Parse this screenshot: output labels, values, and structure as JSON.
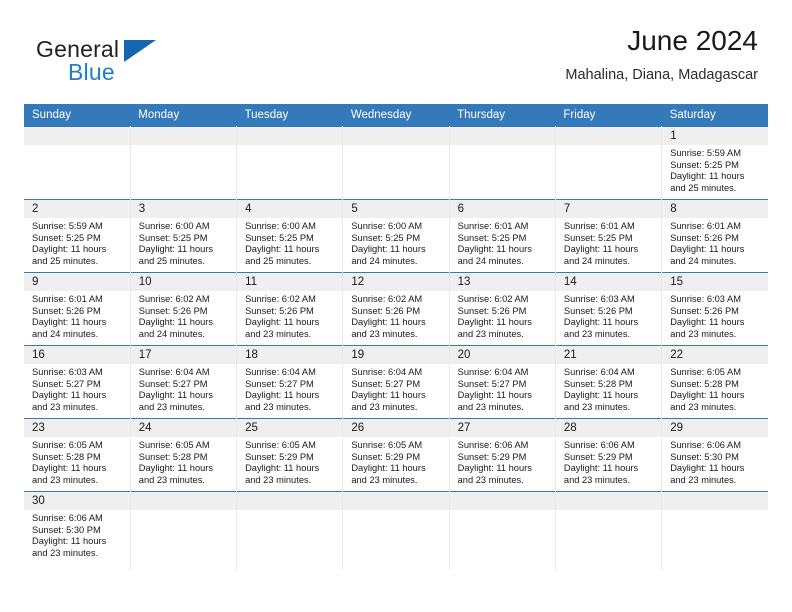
{
  "brand": {
    "logo_top": "General",
    "logo_bottom": "Blue",
    "logo_icon": "blue-triangle",
    "accent_color": "#3479b9",
    "logo_blue": "#1f7ec4",
    "header_band_color": "#efefef"
  },
  "header": {
    "title": "June 2024",
    "subtitle": "Mahalina, Diana, Madagascar"
  },
  "weekdays": [
    "Sunday",
    "Monday",
    "Tuesday",
    "Wednesday",
    "Thursday",
    "Friday",
    "Saturday"
  ],
  "weeks": [
    [
      {
        "date": "",
        "empty": true
      },
      {
        "date": "",
        "empty": true
      },
      {
        "date": "",
        "empty": true
      },
      {
        "date": "",
        "empty": true
      },
      {
        "date": "",
        "empty": true
      },
      {
        "date": "",
        "empty": true
      },
      {
        "date": "1",
        "sunrise": "Sunrise: 5:59 AM",
        "sunset": "Sunset: 5:25 PM",
        "daylight_1": "Daylight: 11 hours",
        "daylight_2": "and 25 minutes."
      }
    ],
    [
      {
        "date": "2",
        "sunrise": "Sunrise: 5:59 AM",
        "sunset": "Sunset: 5:25 PM",
        "daylight_1": "Daylight: 11 hours",
        "daylight_2": "and 25 minutes."
      },
      {
        "date": "3",
        "sunrise": "Sunrise: 6:00 AM",
        "sunset": "Sunset: 5:25 PM",
        "daylight_1": "Daylight: 11 hours",
        "daylight_2": "and 25 minutes."
      },
      {
        "date": "4",
        "sunrise": "Sunrise: 6:00 AM",
        "sunset": "Sunset: 5:25 PM",
        "daylight_1": "Daylight: 11 hours",
        "daylight_2": "and 25 minutes."
      },
      {
        "date": "5",
        "sunrise": "Sunrise: 6:00 AM",
        "sunset": "Sunset: 5:25 PM",
        "daylight_1": "Daylight: 11 hours",
        "daylight_2": "and 24 minutes."
      },
      {
        "date": "6",
        "sunrise": "Sunrise: 6:01 AM",
        "sunset": "Sunset: 5:25 PM",
        "daylight_1": "Daylight: 11 hours",
        "daylight_2": "and 24 minutes."
      },
      {
        "date": "7",
        "sunrise": "Sunrise: 6:01 AM",
        "sunset": "Sunset: 5:25 PM",
        "daylight_1": "Daylight: 11 hours",
        "daylight_2": "and 24 minutes."
      },
      {
        "date": "8",
        "sunrise": "Sunrise: 6:01 AM",
        "sunset": "Sunset: 5:26 PM",
        "daylight_1": "Daylight: 11 hours",
        "daylight_2": "and 24 minutes."
      }
    ],
    [
      {
        "date": "9",
        "sunrise": "Sunrise: 6:01 AM",
        "sunset": "Sunset: 5:26 PM",
        "daylight_1": "Daylight: 11 hours",
        "daylight_2": "and 24 minutes."
      },
      {
        "date": "10",
        "sunrise": "Sunrise: 6:02 AM",
        "sunset": "Sunset: 5:26 PM",
        "daylight_1": "Daylight: 11 hours",
        "daylight_2": "and 24 minutes."
      },
      {
        "date": "11",
        "sunrise": "Sunrise: 6:02 AM",
        "sunset": "Sunset: 5:26 PM",
        "daylight_1": "Daylight: 11 hours",
        "daylight_2": "and 23 minutes."
      },
      {
        "date": "12",
        "sunrise": "Sunrise: 6:02 AM",
        "sunset": "Sunset: 5:26 PM",
        "daylight_1": "Daylight: 11 hours",
        "daylight_2": "and 23 minutes."
      },
      {
        "date": "13",
        "sunrise": "Sunrise: 6:02 AM",
        "sunset": "Sunset: 5:26 PM",
        "daylight_1": "Daylight: 11 hours",
        "daylight_2": "and 23 minutes."
      },
      {
        "date": "14",
        "sunrise": "Sunrise: 6:03 AM",
        "sunset": "Sunset: 5:26 PM",
        "daylight_1": "Daylight: 11 hours",
        "daylight_2": "and 23 minutes."
      },
      {
        "date": "15",
        "sunrise": "Sunrise: 6:03 AM",
        "sunset": "Sunset: 5:26 PM",
        "daylight_1": "Daylight: 11 hours",
        "daylight_2": "and 23 minutes."
      }
    ],
    [
      {
        "date": "16",
        "sunrise": "Sunrise: 6:03 AM",
        "sunset": "Sunset: 5:27 PM",
        "daylight_1": "Daylight: 11 hours",
        "daylight_2": "and 23 minutes."
      },
      {
        "date": "17",
        "sunrise": "Sunrise: 6:04 AM",
        "sunset": "Sunset: 5:27 PM",
        "daylight_1": "Daylight: 11 hours",
        "daylight_2": "and 23 minutes."
      },
      {
        "date": "18",
        "sunrise": "Sunrise: 6:04 AM",
        "sunset": "Sunset: 5:27 PM",
        "daylight_1": "Daylight: 11 hours",
        "daylight_2": "and 23 minutes."
      },
      {
        "date": "19",
        "sunrise": "Sunrise: 6:04 AM",
        "sunset": "Sunset: 5:27 PM",
        "daylight_1": "Daylight: 11 hours",
        "daylight_2": "and 23 minutes."
      },
      {
        "date": "20",
        "sunrise": "Sunrise: 6:04 AM",
        "sunset": "Sunset: 5:27 PM",
        "daylight_1": "Daylight: 11 hours",
        "daylight_2": "and 23 minutes."
      },
      {
        "date": "21",
        "sunrise": "Sunrise: 6:04 AM",
        "sunset": "Sunset: 5:28 PM",
        "daylight_1": "Daylight: 11 hours",
        "daylight_2": "and 23 minutes."
      },
      {
        "date": "22",
        "sunrise": "Sunrise: 6:05 AM",
        "sunset": "Sunset: 5:28 PM",
        "daylight_1": "Daylight: 11 hours",
        "daylight_2": "and 23 minutes."
      }
    ],
    [
      {
        "date": "23",
        "sunrise": "Sunrise: 6:05 AM",
        "sunset": "Sunset: 5:28 PM",
        "daylight_1": "Daylight: 11 hours",
        "daylight_2": "and 23 minutes."
      },
      {
        "date": "24",
        "sunrise": "Sunrise: 6:05 AM",
        "sunset": "Sunset: 5:28 PM",
        "daylight_1": "Daylight: 11 hours",
        "daylight_2": "and 23 minutes."
      },
      {
        "date": "25",
        "sunrise": "Sunrise: 6:05 AM",
        "sunset": "Sunset: 5:29 PM",
        "daylight_1": "Daylight: 11 hours",
        "daylight_2": "and 23 minutes."
      },
      {
        "date": "26",
        "sunrise": "Sunrise: 6:05 AM",
        "sunset": "Sunset: 5:29 PM",
        "daylight_1": "Daylight: 11 hours",
        "daylight_2": "and 23 minutes."
      },
      {
        "date": "27",
        "sunrise": "Sunrise: 6:06 AM",
        "sunset": "Sunset: 5:29 PM",
        "daylight_1": "Daylight: 11 hours",
        "daylight_2": "and 23 minutes."
      },
      {
        "date": "28",
        "sunrise": "Sunrise: 6:06 AM",
        "sunset": "Sunset: 5:29 PM",
        "daylight_1": "Daylight: 11 hours",
        "daylight_2": "and 23 minutes."
      },
      {
        "date": "29",
        "sunrise": "Sunrise: 6:06 AM",
        "sunset": "Sunset: 5:30 PM",
        "daylight_1": "Daylight: 11 hours",
        "daylight_2": "and 23 minutes."
      }
    ],
    [
      {
        "date": "30",
        "sunrise": "Sunrise: 6:06 AM",
        "sunset": "Sunset: 5:30 PM",
        "daylight_1": "Daylight: 11 hours",
        "daylight_2": "and 23 minutes."
      },
      {
        "date": "",
        "empty": true
      },
      {
        "date": "",
        "empty": true
      },
      {
        "date": "",
        "empty": true
      },
      {
        "date": "",
        "empty": true
      },
      {
        "date": "",
        "empty": true
      },
      {
        "date": "",
        "empty": true
      }
    ]
  ]
}
